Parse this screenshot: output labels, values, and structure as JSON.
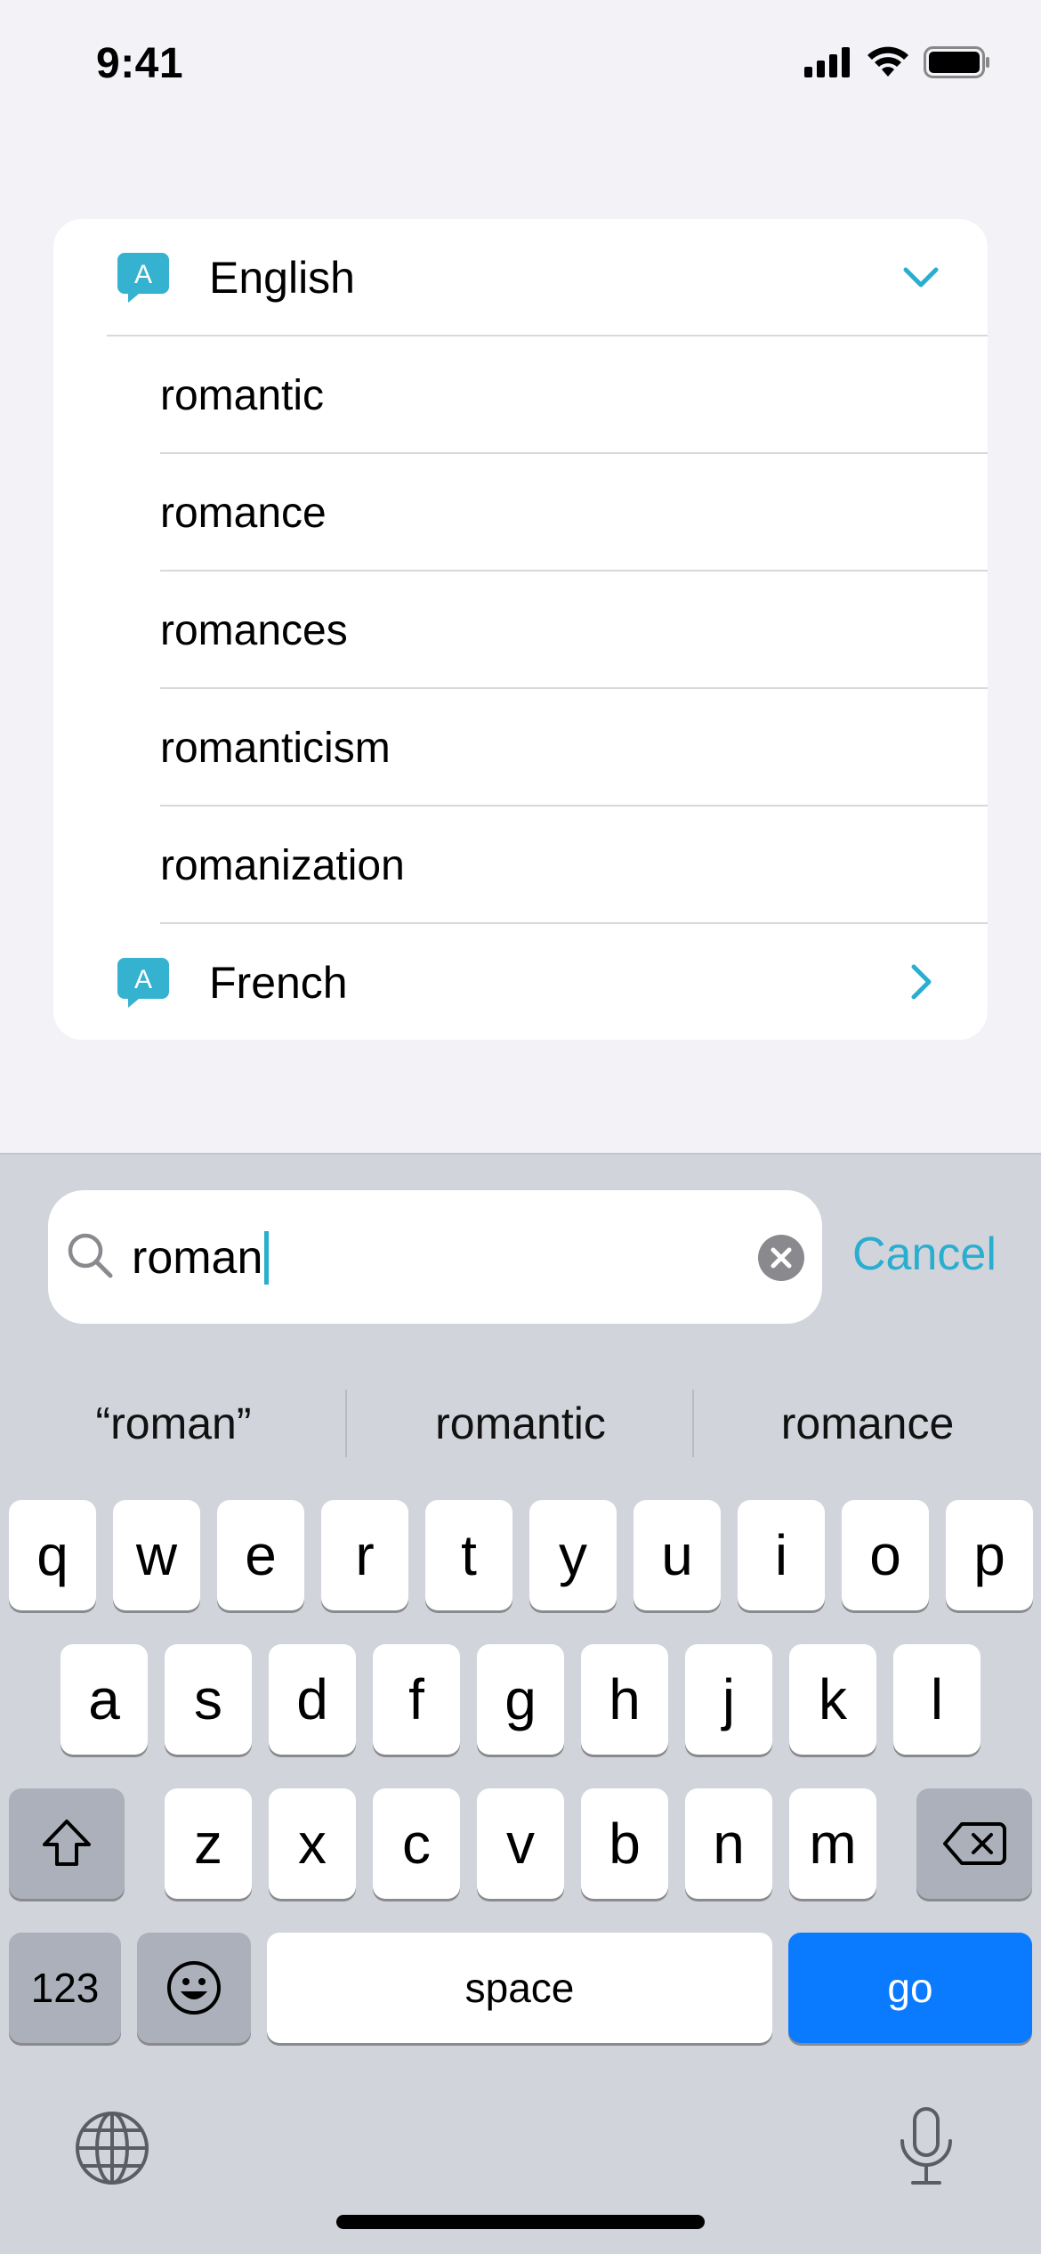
{
  "status_bar": {
    "time": "9:41"
  },
  "list": {
    "sections": [
      {
        "label": "English",
        "expanded": true,
        "icon": "translate-bubble-icon"
      },
      {
        "label": "French",
        "expanded": false,
        "icon": "translate-bubble-icon"
      }
    ],
    "icon_letter": "A",
    "words": [
      "romantic",
      "romance",
      "romances",
      "romanticism",
      "romanization"
    ]
  },
  "search": {
    "value": "roman",
    "cancel_label": "Cancel"
  },
  "suggestions": [
    "“roman”",
    "romantic",
    "romance"
  ],
  "keyboard": {
    "row1": [
      "q",
      "w",
      "e",
      "r",
      "t",
      "y",
      "u",
      "i",
      "o",
      "p"
    ],
    "row2": [
      "a",
      "s",
      "d",
      "f",
      "g",
      "h",
      "j",
      "k",
      "l"
    ],
    "row3": [
      "z",
      "x",
      "c",
      "v",
      "b",
      "n",
      "m"
    ],
    "numbers_label": "123",
    "space_label": "space",
    "go_label": "go"
  },
  "colors": {
    "accent": "#2aaed0",
    "go": "#0a7aff",
    "keyboard_bg": "#d1d4db"
  }
}
